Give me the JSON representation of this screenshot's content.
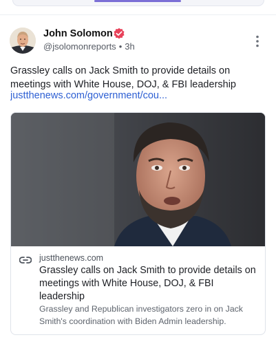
{
  "post": {
    "author_name": "John Solomon",
    "author_handle": "@jsolomonreports",
    "separator": "•",
    "timestamp": "3h",
    "text": "Grassley calls on Jack Smith to provide details on meetings with White House, DOJ, & FBI leadership",
    "link_text": "justthenews.com/government/cou..."
  },
  "card": {
    "domain": "justthenews.com",
    "title": "Grassley calls on Jack Smith to provide details on meetings with White House, DOJ, & FBI leadership",
    "description": "Grassley and Republican investigators zero in on Jack Smith's coordination with Biden Admin leadership."
  },
  "icons": {
    "verified": "verified-badge-icon",
    "more": "more-vertical-icon",
    "link": "link-icon"
  },
  "colors": {
    "accent": "#7b6fd6",
    "link": "#2d5fd3",
    "verified": "#e8425a"
  }
}
